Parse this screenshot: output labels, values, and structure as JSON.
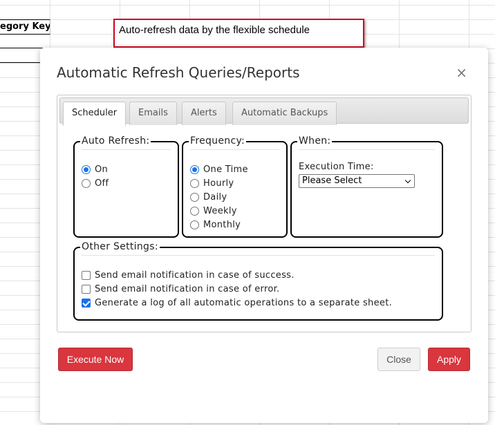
{
  "sheet": {
    "cell_text": "egory Key"
  },
  "callout": {
    "text": "Auto-refresh data by the flexible schedule"
  },
  "dialog": {
    "title": "Automatic Refresh Queries/Reports",
    "close_glyph": "×",
    "tabs": [
      {
        "label": "Scheduler",
        "active": true
      },
      {
        "label": "Emails",
        "active": false
      },
      {
        "label": "Alerts",
        "active": false
      },
      {
        "label": "Automatic Backups",
        "active": false
      }
    ],
    "auto_refresh": {
      "legend": "Auto Refresh:",
      "options": [
        {
          "label": "On",
          "selected": true
        },
        {
          "label": "Off",
          "selected": false
        }
      ]
    },
    "frequency": {
      "legend": "Frequency:",
      "options": [
        {
          "label": "One Time",
          "selected": true
        },
        {
          "label": "Hourly",
          "selected": false
        },
        {
          "label": "Daily",
          "selected": false
        },
        {
          "label": "Weekly",
          "selected": false
        },
        {
          "label": "Monthly",
          "selected": false
        }
      ]
    },
    "when": {
      "legend": "When:",
      "execution_label": "Execution Time:",
      "select_value": "Please Select"
    },
    "other_settings": {
      "legend": "Other Settings:",
      "options": [
        {
          "label": "Send email notification in case of success.",
          "checked": false
        },
        {
          "label": "Send email notification in case of error.",
          "checked": false
        },
        {
          "label": "Generate a log of all automatic operations to a separate sheet.",
          "checked": true
        }
      ]
    },
    "buttons": {
      "execute": "Execute Now",
      "close": "Close",
      "apply": "Apply"
    }
  },
  "colors": {
    "accent": "#1a73e8",
    "primary_button": "#d9363e",
    "callout_border": "#d0021b"
  }
}
